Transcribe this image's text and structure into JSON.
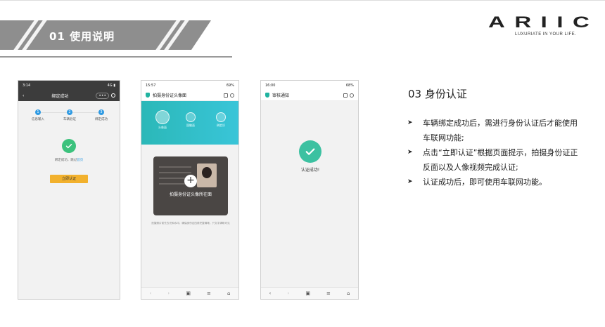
{
  "header": {
    "title": "01 使用说明"
  },
  "logo": {
    "text": "ARIIC",
    "tagline": "LUXURIATE IN YOUR LIFE."
  },
  "phone1": {
    "time": "3:14",
    "status": "4G ▮",
    "title": "绑定成功",
    "capsule": "•••",
    "steps": [
      {
        "num": "1",
        "label": "信息输入"
      },
      {
        "num": "2",
        "label": "车辆验证"
      },
      {
        "num": "3",
        "label": "绑定成功"
      }
    ],
    "message": "绑定成功，跳过",
    "message_link": "首页",
    "button": "立即认证"
  },
  "phone2": {
    "time": "15:57",
    "status": "69%",
    "title": "拍摄身份证头像面",
    "steps": [
      "头像面",
      "国徽面",
      "刷脸识"
    ],
    "card_hint": "拍摄身份证头像所在面",
    "tip": "拍摄照片前先去光和水印，确保身份证四角完整清晰，只文字清晰可见"
  },
  "phone3": {
    "time": "16:00",
    "status": "68%",
    "title": "审核通知",
    "message": "认证成功!"
  },
  "section": {
    "title": "03 身份认证",
    "bullets": [
      "车辆绑定成功后，需进行身份认证后才能使用车联网功能;",
      "点击“立即认证”根据页面提示，拍摄身份证正反面以及人像视频完成认证;",
      "认证成功后，即可使用车联网功能。"
    ]
  },
  "colors": {
    "teal": "#2bb8b8",
    "green": "#3cc27d",
    "yellow": "#f2b12d",
    "banner": "#8e8e8e"
  }
}
